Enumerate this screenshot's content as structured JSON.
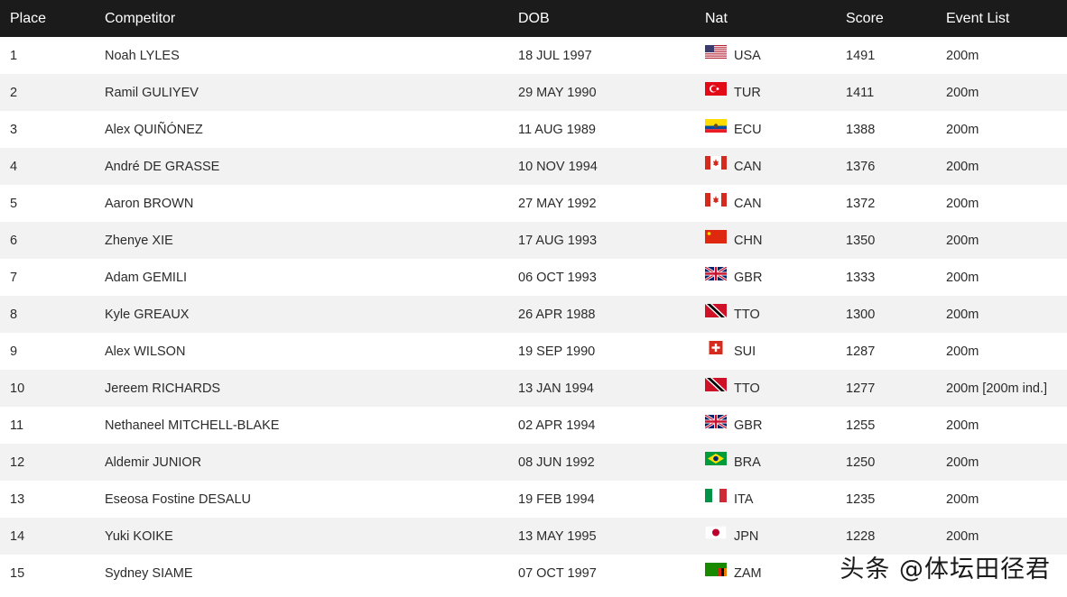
{
  "table": {
    "headers": {
      "place": "Place",
      "competitor": "Competitor",
      "dob": "DOB",
      "nat": "Nat",
      "score": "Score",
      "events": "Event List"
    },
    "rows": [
      {
        "place": "1",
        "competitor": "Noah LYLES",
        "dob": "18 JUL 1997",
        "nat": "USA",
        "score": "1491",
        "events": "200m"
      },
      {
        "place": "2",
        "competitor": "Ramil GULIYEV",
        "dob": "29 MAY 1990",
        "nat": "TUR",
        "score": "1411",
        "events": "200m"
      },
      {
        "place": "3",
        "competitor": "Alex QUIÑÓNEZ",
        "dob": "11 AUG 1989",
        "nat": "ECU",
        "score": "1388",
        "events": "200m"
      },
      {
        "place": "4",
        "competitor": "André DE GRASSE",
        "dob": "10 NOV 1994",
        "nat": "CAN",
        "score": "1376",
        "events": "200m"
      },
      {
        "place": "5",
        "competitor": "Aaron BROWN",
        "dob": "27 MAY 1992",
        "nat": "CAN",
        "score": "1372",
        "events": "200m"
      },
      {
        "place": "6",
        "competitor": "Zhenye XIE",
        "dob": "17 AUG 1993",
        "nat": "CHN",
        "score": "1350",
        "events": "200m"
      },
      {
        "place": "7",
        "competitor": "Adam GEMILI",
        "dob": "06 OCT 1993",
        "nat": "GBR",
        "score": "1333",
        "events": "200m"
      },
      {
        "place": "8",
        "competitor": "Kyle GREAUX",
        "dob": "26 APR 1988",
        "nat": "TTO",
        "score": "1300",
        "events": "200m"
      },
      {
        "place": "9",
        "competitor": "Alex WILSON",
        "dob": "19 SEP 1990",
        "nat": "SUI",
        "score": "1287",
        "events": "200m"
      },
      {
        "place": "10",
        "competitor": "Jereem RICHARDS",
        "dob": "13 JAN 1994",
        "nat": "TTO",
        "score": "1277",
        "events": "200m [200m ind.]"
      },
      {
        "place": "11",
        "competitor": "Nethaneel MITCHELL-BLAKE",
        "dob": "02 APR 1994",
        "nat": "GBR",
        "score": "1255",
        "events": "200m"
      },
      {
        "place": "12",
        "competitor": "Aldemir JUNIOR",
        "dob": "08 JUN 1992",
        "nat": "BRA",
        "score": "1250",
        "events": "200m"
      },
      {
        "place": "13",
        "competitor": "Eseosa Fostine DESALU",
        "dob": "19 FEB 1994",
        "nat": "ITA",
        "score": "1235",
        "events": "200m"
      },
      {
        "place": "14",
        "competitor": "Yuki KOIKE",
        "dob": "13 MAY 1995",
        "nat": "JPN",
        "score": "1228",
        "events": "200m"
      },
      {
        "place": "15",
        "competitor": "Sydney SIAME",
        "dob": "07 OCT 1997",
        "nat": "ZAM",
        "score": "",
        "events": ""
      }
    ]
  },
  "watermark": "头条 @体坛田径君",
  "colors": {
    "header_bg": "#1b1b1b",
    "header_text": "#ffffff",
    "row_alt_bg": "#f2f2f2"
  }
}
